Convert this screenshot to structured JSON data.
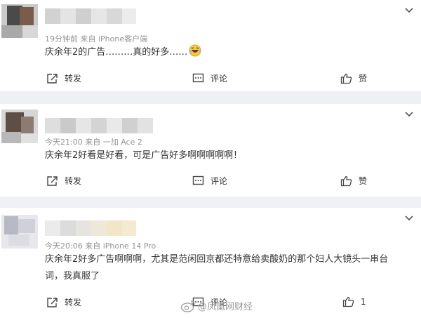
{
  "comments": [
    {
      "meta": "19分钟前  来自 iPhone客户端",
      "text": "庆余年2的广告………真的好多……",
      "actions": {
        "repost": "转发",
        "comment": "评论",
        "like": "赞"
      }
    },
    {
      "meta": "今天21:00  来自 一加 Ace 2",
      "text": "庆余年2好看是好看，可是广告好多啊啊啊啊啊！",
      "actions": {
        "repost": "转发",
        "comment": "评论",
        "like": "赞"
      }
    },
    {
      "meta": "今天20:06  来自 iPhone 14 Pro",
      "text_line1": "庆余年2好多广告啊啊啊，尤其是范闲回京都还特意给卖酸奶的那个妇人大镜头一串台",
      "text_line2": "词，我真服了",
      "actions": {
        "repost": "转发",
        "comment": "评论",
        "like": "1"
      }
    }
  ],
  "watermark": "@凤凰网财经",
  "icons": {
    "emoji": "laughing-emoji",
    "repost": "repost-icon",
    "comment": "comment-icon",
    "like": "thumbs-up-icon",
    "menu": "chevron-down-icon"
  },
  "colors": {
    "background": "#eef0f3",
    "card": "#ffffff",
    "meta": "#939393",
    "text": "#333333"
  }
}
